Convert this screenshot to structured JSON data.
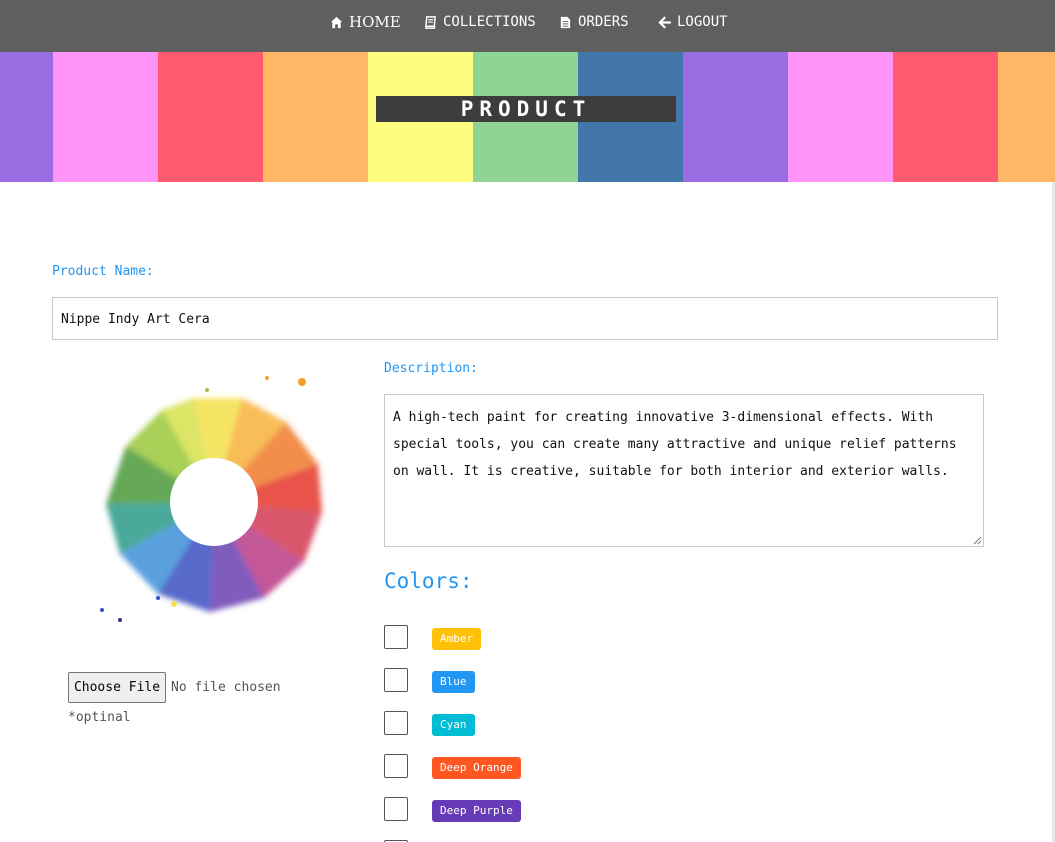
{
  "nav": {
    "items": [
      {
        "label": "HOME",
        "icon": "home-icon"
      },
      {
        "label": "COLLECTIONS",
        "icon": "book-icon"
      },
      {
        "label": "ORDERS",
        "icon": "file-icon"
      },
      {
        "label": "LOGOUT",
        "icon": "arrow-left-icon"
      }
    ]
  },
  "banner": {
    "title": "PRODUCT",
    "stripe_colors": [
      "#9b6de3",
      "#ff94f8",
      "#ff5a6e",
      "#ffb766",
      "#fffd80",
      "#8fd395",
      "#4376ab",
      "#9b6de3",
      "#ff94f8",
      "#ff5a6e",
      "#ffb766"
    ]
  },
  "form": {
    "product_name_label": "Product Name:",
    "product_name_value": "Nippe Indy Art Cera",
    "description_label": "Description:",
    "description_value": "A high-tech paint for creating innovative 3-dimensional effects. With special tools, you can create many attractive and unique relief patterns on wall. It is creative, suitable for both interior and exterior walls.",
    "file_button_label": "Choose File",
    "file_status": "No file chosen",
    "file_note": "*optinal",
    "image_icon": "color-wheel-image"
  },
  "colors": {
    "heading": "Colors:",
    "options": [
      {
        "name": "Amber",
        "color": "#ffc107",
        "checked": false
      },
      {
        "name": "Blue",
        "color": "#2196f3",
        "checked": false
      },
      {
        "name": "Cyan",
        "color": "#00bcd4",
        "checked": false
      },
      {
        "name": "Deep Orange",
        "color": "#ff5722",
        "checked": false
      },
      {
        "name": "Deep Purple",
        "color": "#673ab7",
        "checked": false
      }
    ]
  },
  "theme": {
    "nav_bg": "#5f5f5f",
    "accent": "#2196f3"
  }
}
